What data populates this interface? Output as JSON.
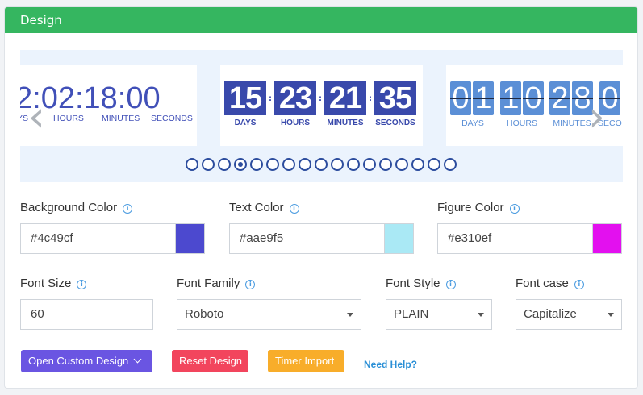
{
  "panel": {
    "title": "Design"
  },
  "carousel": {
    "timer1": {
      "digits": "2:02:18:00",
      "labels": [
        "YS",
        "HOURS",
        "MINUTES",
        "SECONDS"
      ]
    },
    "timer2": {
      "values": [
        "15",
        "23",
        "21",
        "35"
      ],
      "labels": [
        "DAYS",
        "HOURS",
        "MINUTES",
        "SECONDS"
      ]
    },
    "timer3": {
      "digits": [
        "0",
        "1",
        "1",
        "0",
        "2",
        "8",
        "0"
      ],
      "labels": [
        "DAYS",
        "HOURS",
        "MINUTES",
        "SECO"
      ]
    },
    "prev_icon": "chevron-left-icon",
    "next_icon": "chevron-right-icon",
    "dot_count": 17,
    "active_dot": 4
  },
  "colors": {
    "background": {
      "label": "Background Color",
      "value": "#4c49cf"
    },
    "text": {
      "label": "Text Color",
      "value": "#aae9f5"
    },
    "figure": {
      "label": "Figure Color",
      "value": "#e310ef"
    }
  },
  "font": {
    "size": {
      "label": "Font Size",
      "value": "60"
    },
    "family": {
      "label": "Font Family",
      "value": "Roboto"
    },
    "style": {
      "label": "Font Style",
      "value": "PLAIN"
    },
    "case": {
      "label": "Font case",
      "value": "Capitalize"
    }
  },
  "actions": {
    "open_custom": "Open Custom Design",
    "reset": "Reset Design",
    "import": "Timer Import",
    "help": "Need Help?"
  }
}
